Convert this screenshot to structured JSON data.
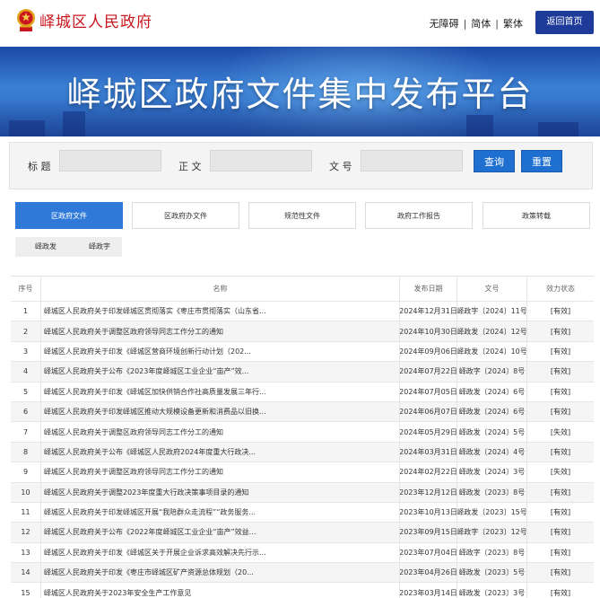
{
  "header": {
    "site_name": "峄城区人民政府",
    "links": [
      "无障碍",
      "简体",
      "繁体"
    ],
    "home_button": "返回首页",
    "colors": {
      "brand_red": "#c9151e",
      "home_btn": "#1f3b9a"
    }
  },
  "banner": {
    "title": "峄城区政府文件集中发布平台"
  },
  "search": {
    "title_label": "标 题",
    "body_label": "正 文",
    "docno_label": "文 号",
    "title_value": "",
    "body_value": "",
    "docno_value": "",
    "query_button": "查询",
    "reset_button": "重置"
  },
  "tabs": [
    {
      "label": "区政府文件",
      "active": true
    },
    {
      "label": "区政府办文件",
      "active": false
    },
    {
      "label": "规范性文件",
      "active": false
    },
    {
      "label": "政府工作报告",
      "active": false
    },
    {
      "label": "政策转载",
      "active": false
    }
  ],
  "subtabs": [
    "峄政发",
    "峄政字"
  ],
  "table": {
    "headers": [
      "序号",
      "名称",
      "发布日期",
      "文号",
      "效力状态"
    ],
    "rows": [
      [
        "1",
        "峄城区人民政府关于印发峄城区贯彻落实《枣庄市贯彻落实（山东省...",
        "2024年12月31日",
        "峄政字〔2024〕11号",
        "[有效]"
      ],
      [
        "2",
        "峄城区人民政府关于调整区政府领导同志工作分工的通知",
        "2024年10月30日",
        "峄政发〔2024〕12号",
        "[有效]"
      ],
      [
        "3",
        "峄城区人民政府关于印发《峄城区营商环境创新行动计划（202...",
        "2024年09月06日",
        "峄政发〔2024〕10号",
        "[有效]"
      ],
      [
        "4",
        "峄城区人民政府关于公布《2023年度峄城区工业企业“亩产”效...",
        "2024年07月22日",
        "峄政字〔2024〕8号",
        "[有效]"
      ],
      [
        "5",
        "峄城区人民政府关于印发《峄城区加快供销合作社高质量发展三年行...",
        "2024年07月05日",
        "峄政发〔2024〕6号",
        "[有效]"
      ],
      [
        "6",
        "峄城区人民政府关于印发峄城区推动大规模设备更新和消费品以旧换...",
        "2024年06月07日",
        "峄政发〔2024〕6号",
        "[有效]"
      ],
      [
        "7",
        "峄城区人民政府关于调整区政府领导同志工作分工的通知",
        "2024年05月29日",
        "峄政发〔2024〕5号",
        "[失效]"
      ],
      [
        "8",
        "峄城区人民政府关于公布《峄城区人民政府2024年度重大行政决...",
        "2024年03月31日",
        "峄政发〔2024〕4号",
        "[有效]"
      ],
      [
        "9",
        "峄城区人民政府关于调整区政府领导同志工作分工的通知",
        "2024年02月22日",
        "峄政发〔2024〕3号",
        "[失效]"
      ],
      [
        "10",
        "峄城区人民政府关于调整2023年度重大行政决策事项目录的通知",
        "2023年12月12日",
        "峄政发〔2023〕8号",
        "[有效]"
      ],
      [
        "11",
        "峄城区人民政府关于印发峄城区开展“我陪群众走流程”“政务服务...",
        "2023年10月13日",
        "峄政发〔2023〕15号",
        "[有效]"
      ],
      [
        "12",
        "峄城区人民政府关于公布《2022年度峄城区工业企业“亩产”效益...",
        "2023年09月15日",
        "峄政字〔2023〕12号",
        "[有效]"
      ],
      [
        "13",
        "峄城区人民政府关于印发《峄城区关于开展企业诉求高效解决先行示...",
        "2023年07月04日",
        "峄政字〔2023〕8号",
        "[有效]"
      ],
      [
        "14",
        "峄城区人民政府关于印发《枣庄市峄城区矿产资源总体规划（20...",
        "2023年04月26日",
        "峄政发〔2023〕5号",
        "[有效]"
      ],
      [
        "15",
        "峄城区人民政府关于2023年安全生产工作意见",
        "2023年03月14日",
        "峄政发〔2023〕3号",
        "[有效]"
      ]
    ]
  }
}
